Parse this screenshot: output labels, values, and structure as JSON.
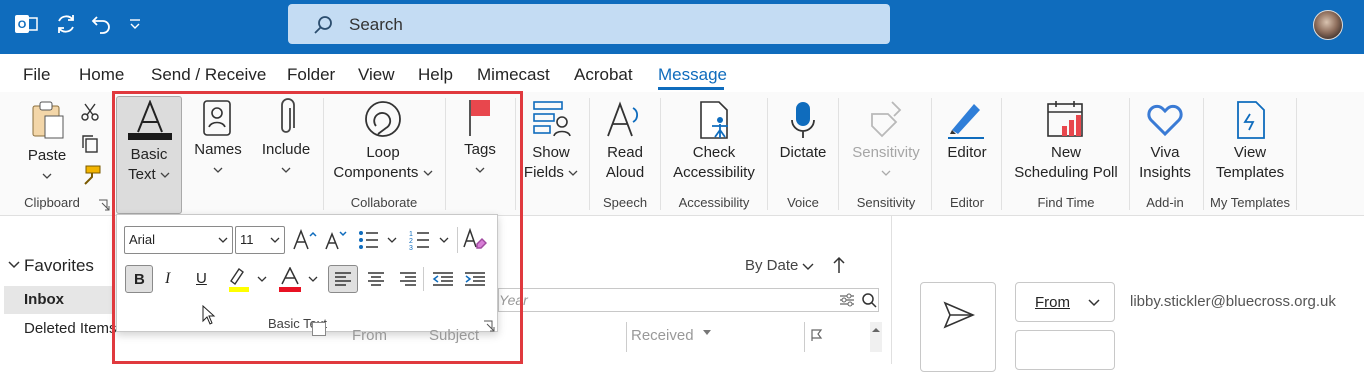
{
  "search": {
    "placeholder": "Search"
  },
  "menu": [
    "File",
    "Home",
    "Send / Receive",
    "Folder",
    "View",
    "Help",
    "Mimecast",
    "Acrobat",
    "Message"
  ],
  "ribbon": {
    "paste": "Paste",
    "basic_text": [
      "Basic",
      "Text"
    ],
    "names": "Names",
    "include": "Include",
    "loop": [
      "Loop",
      "Components"
    ],
    "tags": "Tags",
    "show_fields": [
      "Show",
      "Fields"
    ],
    "read_aloud": [
      "Read",
      "Aloud"
    ],
    "check_access": [
      "Check",
      "Accessibility"
    ],
    "dictate": "Dictate",
    "sensitivity": "Sensitivity",
    "editor": "Editor",
    "scheduling_poll": [
      "New",
      "Scheduling Poll"
    ],
    "viva": [
      "Viva",
      "Insights"
    ],
    "templates": [
      "View",
      "Templates"
    ],
    "groups": {
      "clipboard": "Clipboard",
      "collaborate": "Collaborate",
      "speech": "Speech",
      "accessibility": "Accessibility",
      "voice": "Voice",
      "sensitivity": "Sensitivity",
      "editor": "Editor",
      "find_time": "Find Time",
      "addin": "Add-in",
      "my_templates": "My Templates"
    }
  },
  "basic_text_popup": {
    "font": "Arial",
    "size": "11",
    "group_label": "Basic Text"
  },
  "nav": {
    "favorites": "Favorites",
    "inbox": "Inbox",
    "deleted": "Deleted Items"
  },
  "list": {
    "sort": "By Date",
    "search_hint": "Year",
    "col_from": "From",
    "col_subject": "Subject",
    "col_received": "Received"
  },
  "compose": {
    "from_button": "From",
    "from_address": "libby.stickler@bluecross.org.uk"
  },
  "colors": {
    "accent": "#0f6cbd",
    "highlight": "#ffff00",
    "font_color": "#e81123",
    "annotation": "#e0393e"
  }
}
